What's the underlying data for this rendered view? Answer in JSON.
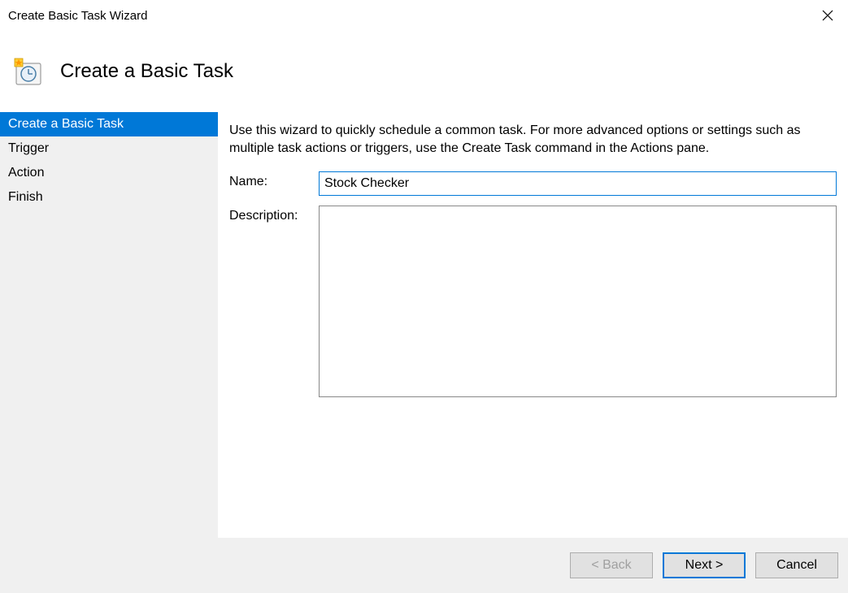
{
  "window": {
    "title": "Create Basic Task Wizard"
  },
  "header": {
    "title": "Create a Basic Task"
  },
  "sidebar": {
    "items": [
      {
        "label": "Create a Basic Task",
        "selected": true
      },
      {
        "label": "Trigger",
        "selected": false
      },
      {
        "label": "Action",
        "selected": false
      },
      {
        "label": "Finish",
        "selected": false
      }
    ]
  },
  "main": {
    "instruction": "Use this wizard to quickly schedule a common task.  For more advanced options or settings such as multiple task actions or triggers, use the Create Task command in the Actions pane.",
    "name_label": "Name:",
    "name_value": "Stock Checker",
    "description_label": "Description:",
    "description_value": ""
  },
  "footer": {
    "back_label": "< Back",
    "next_label": "Next >",
    "cancel_label": "Cancel"
  }
}
